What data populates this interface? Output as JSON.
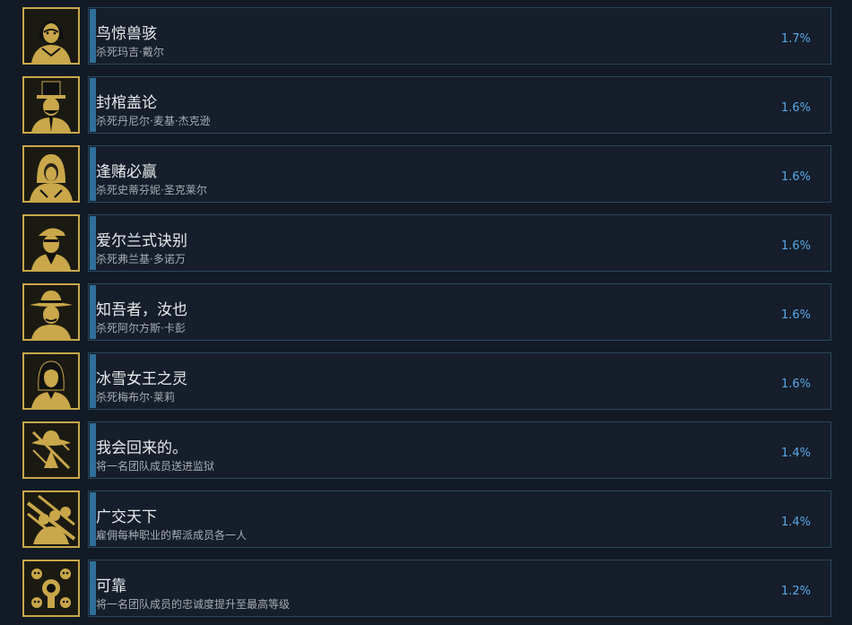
{
  "achievements": [
    {
      "title": "鸟惊兽骇",
      "desc": "杀死玛吉·戴尔",
      "pct": "1.7%",
      "icon": "woman-portrait-icon"
    },
    {
      "title": "封棺盖论",
      "desc": "杀死丹尼尔·麦基·杰克逊",
      "pct": "1.6%",
      "icon": "top-hat-man-portrait-icon"
    },
    {
      "title": "逢赌必赢",
      "desc": "杀死史蒂芬妮·圣克莱尔",
      "pct": "1.6%",
      "icon": "hooded-figure-portrait-icon"
    },
    {
      "title": "爱尔兰式诀别",
      "desc": "杀死弗兰基·多诺万",
      "pct": "1.6%",
      "icon": "cap-man-portrait-icon"
    },
    {
      "title": "知吾者，汝也",
      "desc": "杀死阿尔方斯·卡彭",
      "pct": "1.6%",
      "icon": "fedora-man-portrait-icon"
    },
    {
      "title": "冰雪女王之灵",
      "desc": "杀死梅布尔·莱莉",
      "pct": "1.6%",
      "icon": "woman-portrait-icon-2"
    },
    {
      "title": "我会回来的。",
      "desc": "将一名团队成员送进监狱",
      "pct": "1.4%",
      "icon": "behind-bars-icon"
    },
    {
      "title": "广交天下",
      "desc": "雇佣每种职业的帮派成员各一人",
      "pct": "1.4%",
      "icon": "gang-group-icon"
    },
    {
      "title": "可靠",
      "desc": "将一名团队成员的忠诚度提升至最高等级",
      "pct": "1.2%",
      "icon": "skulls-pistol-icon"
    }
  ],
  "colors": {
    "background": "#121a26",
    "panel": "#151e2a",
    "panel_border": "#2a475e",
    "accent": "#2e6f99",
    "icon_gold": "#c9a74a",
    "percent": "#58a8e8"
  }
}
